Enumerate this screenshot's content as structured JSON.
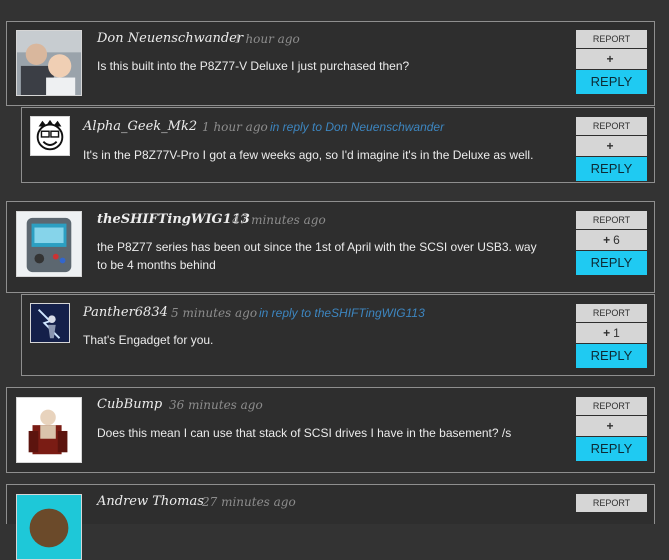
{
  "buttons": {
    "report_label": "REPORT",
    "plus_symbol": "+",
    "reply_label": "REPLY"
  },
  "colors": {
    "background": "#333333",
    "reply_button": "#1fcaf2",
    "reply_link": "#3d86c0",
    "border": "#8f8f8f"
  },
  "comments": [
    {
      "author": "Don Neuenschwander",
      "time": "1 hour ago",
      "text": "Is this built into the P8Z77-V Deluxe I just purchased then?",
      "votes": "",
      "avatar_icon": "user-photo-icon"
    },
    {
      "author": "Alpha_Geek_Mk2",
      "time": "1 hour ago",
      "reply_to": "in reply to Don Neuenschwander",
      "text": "It's in the P8Z77V-Pro I got a few weeks ago, so I'd imagine it's in the Deluxe as well.",
      "votes": "",
      "avatar_icon": "cartoon-face-icon"
    },
    {
      "author": "theSHIFTingWIG113",
      "time": "47 minutes ago",
      "text": "the P8Z77 series has been out since the 1st of April with the SCSI over USB3. way to be 4 months behind",
      "votes": "6",
      "avatar_icon": "handheld-device-icon"
    },
    {
      "author": "Panther6834",
      "time": "5 minutes ago",
      "reply_to": "in reply to theSHIFTingWIG113",
      "text": "That's Engadget for you.",
      "votes": "1",
      "avatar_icon": "lightning-figure-icon"
    },
    {
      "author": "CubBump",
      "time": "36 minutes ago",
      "text": "Does this mean I can use that stack of SCSI drives I have in the basement? /s",
      "votes": "",
      "avatar_icon": "armchair-icon"
    },
    {
      "author": "Andrew Thomas",
      "time": "27 minutes ago",
      "text": "",
      "votes": "",
      "avatar_icon": "user-photo-icon"
    }
  ]
}
